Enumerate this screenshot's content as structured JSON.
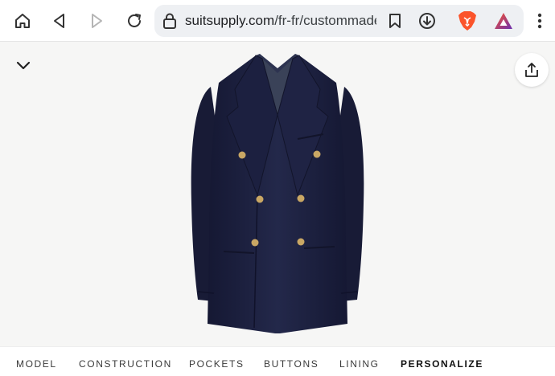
{
  "browser": {
    "url_domain": "suitsupply.com",
    "url_path": "/fr-fr/custommade",
    "icons": {
      "home": "home-icon",
      "back": "back-triangle-icon",
      "forward": "forward-triangle-icon",
      "reload": "reload-icon",
      "lock": "lock-icon",
      "bookmark": "bookmark-icon",
      "download": "download-icon",
      "brave": "brave-lion-icon",
      "rewards": "brave-rewards-triangle-icon",
      "menu": "kebab-menu-icon"
    }
  },
  "page": {
    "collapse_icon": "chevron-down-icon",
    "share_icon": "share-icon",
    "product": "navy double-breasted jacket with gold buttons"
  },
  "tabs": [
    {
      "label": "MODEL",
      "active": false
    },
    {
      "label": "CONSTRUCTION",
      "active": false
    },
    {
      "label": "POCKETS",
      "active": false
    },
    {
      "label": "BUTTONS",
      "active": false
    },
    {
      "label": "LINING",
      "active": false
    },
    {
      "label": "PERSONALIZE",
      "active": true
    }
  ],
  "colors": {
    "jacket": "#1f2340",
    "buttons": "#c9a764",
    "brave_orange": "#fb542b",
    "rewards_purple": "#6b2fb0"
  }
}
